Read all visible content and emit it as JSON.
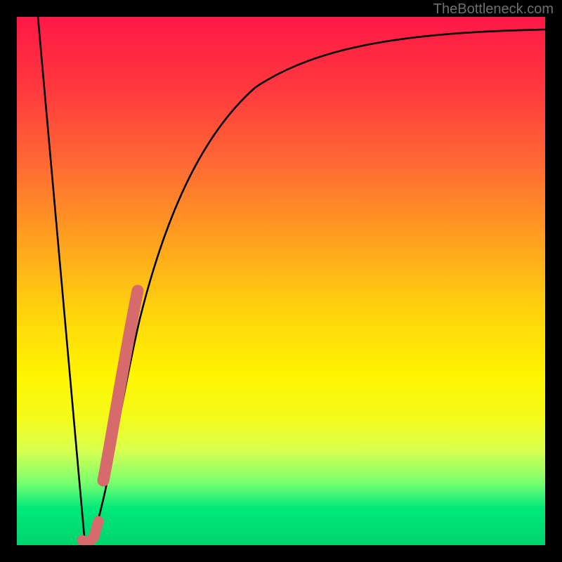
{
  "watermark": "TheBottleneck.com",
  "colors": {
    "frame": "#000000",
    "curve": "#000000",
    "accent": "#d76a6a"
  },
  "chart_data": {
    "type": "line",
    "title": "",
    "xlabel": "",
    "ylabel": "",
    "xlim": [
      0,
      100
    ],
    "ylim": [
      0,
      100
    ],
    "grid": false,
    "series": [
      {
        "name": "bottleneck-curve",
        "x": [
          0,
          5,
          10,
          12,
          15,
          18,
          20,
          22,
          25,
          30,
          35,
          40,
          50,
          60,
          70,
          80,
          90,
          100
        ],
        "y": [
          98,
          60,
          20,
          2,
          8,
          30,
          42,
          51,
          60,
          70,
          77,
          82,
          88,
          91,
          93,
          94.5,
          95.5,
          96
        ]
      }
    ],
    "annotations": [
      {
        "name": "highlight-segment",
        "x_range": [
          15.5,
          22
        ],
        "y_range": [
          12,
          52
        ],
        "style": "thick-coral"
      },
      {
        "name": "valley-marker",
        "x_range": [
          11,
          13.5
        ],
        "y_range": [
          0,
          5
        ],
        "style": "thick-coral"
      }
    ]
  }
}
